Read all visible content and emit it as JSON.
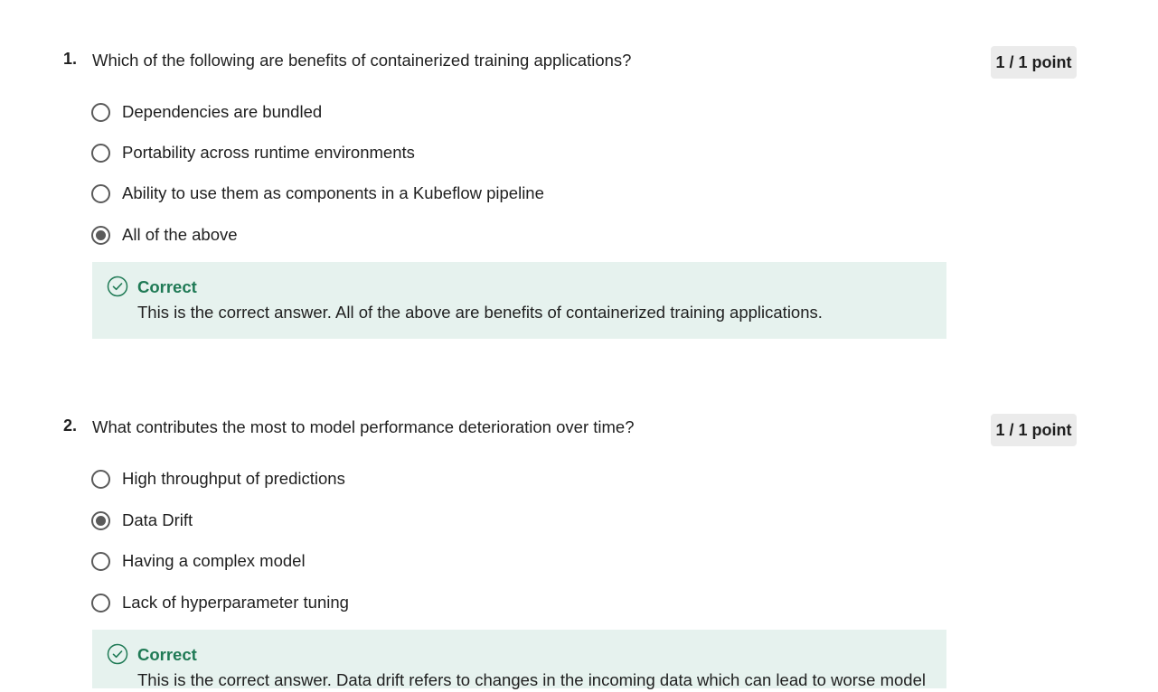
{
  "questions": [
    {
      "number": "1.",
      "text": "Which of the following are benefits of containerized training applications?",
      "points": "1 / 1 point",
      "options": [
        {
          "label": "Dependencies are bundled",
          "selected": false
        },
        {
          "label": "Portability across runtime environments",
          "selected": false
        },
        {
          "label": "Ability to use them as components in a Kubeflow pipeline",
          "selected": false
        },
        {
          "label": "All of the above",
          "selected": true
        }
      ],
      "feedback": {
        "status": "Correct",
        "explanation": "This is the correct answer. All of the above are benefits of containerized training applications."
      }
    },
    {
      "number": "2.",
      "text": "What contributes the most to model performance deterioration over time?",
      "points": "1 / 1 point",
      "options": [
        {
          "label": "High throughput of predictions",
          "selected": false
        },
        {
          "label": "Data Drift",
          "selected": true
        },
        {
          "label": "Having a complex model",
          "selected": false
        },
        {
          "label": "Lack of hyperparameter tuning",
          "selected": false
        }
      ],
      "feedback": {
        "status": "Correct",
        "explanation": "This is the correct answer. Data drift refers to changes in the incoming data which can lead to worse model"
      }
    }
  ],
  "colors": {
    "correct_green": "#1f7a55",
    "feedback_bg": "#e6f2ee",
    "points_bg": "#ebebeb",
    "radio_gray": "#5a5a5a"
  },
  "icons": {
    "radio_unselected": "radio-unselected-icon",
    "radio_selected": "radio-selected-icon",
    "feedback_check": "check-circle-icon"
  }
}
